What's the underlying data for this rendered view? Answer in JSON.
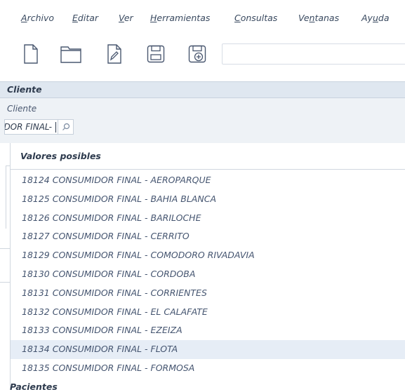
{
  "menu": {
    "items": [
      {
        "pre": "",
        "ul": "A",
        "post": "rchivo"
      },
      {
        "pre": "",
        "ul": "E",
        "post": "ditar"
      },
      {
        "pre": "",
        "ul": "V",
        "post": "er"
      },
      {
        "pre": "",
        "ul": "H",
        "post": "erramientas"
      },
      {
        "pre": "",
        "ul": "C",
        "post": "onsultas"
      },
      {
        "pre": "Ve",
        "ul": "n",
        "post": "tanas"
      },
      {
        "pre": "Ay",
        "ul": "u",
        "post": "da"
      }
    ]
  },
  "toolbar": {
    "icons": [
      "new-file-icon",
      "folder-icon",
      "edit-icon",
      "save-icon",
      "save-add-icon"
    ],
    "search_value": ""
  },
  "cliente": {
    "section_title": "Cliente",
    "field_label": "Cliente",
    "field_value": "CONSUMIDOR FINAL-"
  },
  "dropdown": {
    "header": "Valores posibles",
    "items": [
      "18124 CONSUMIDOR FINAL - AEROPARQUE",
      "18125 CONSUMIDOR FINAL - BAHIA BLANCA",
      "18126 CONSUMIDOR FINAL - BARILOCHE",
      "18127 CONSUMIDOR FINAL - CERRITO",
      "18129 CONSUMIDOR FINAL - COMODORO RIVADAVIA",
      "18130 CONSUMIDOR FINAL - CORDOBA",
      "18131 CONSUMIDOR FINAL - CORRIENTES",
      "18132 CONSUMIDOR FINAL - EL CALAFATE",
      "18133 CONSUMIDOR FINAL - EZEIZA",
      "18134 CONSUMIDOR FINAL - FLOTA",
      "18135 CONSUMIDOR FINAL - FORMOSA"
    ],
    "highlighted_index": 9,
    "footer_partial": "Pacientes"
  },
  "colors": {
    "section_header_bg": "#dfe7f0",
    "panel_bg": "#eef2f6",
    "highlight_bg": "#e6edf6",
    "text": "#455570"
  }
}
